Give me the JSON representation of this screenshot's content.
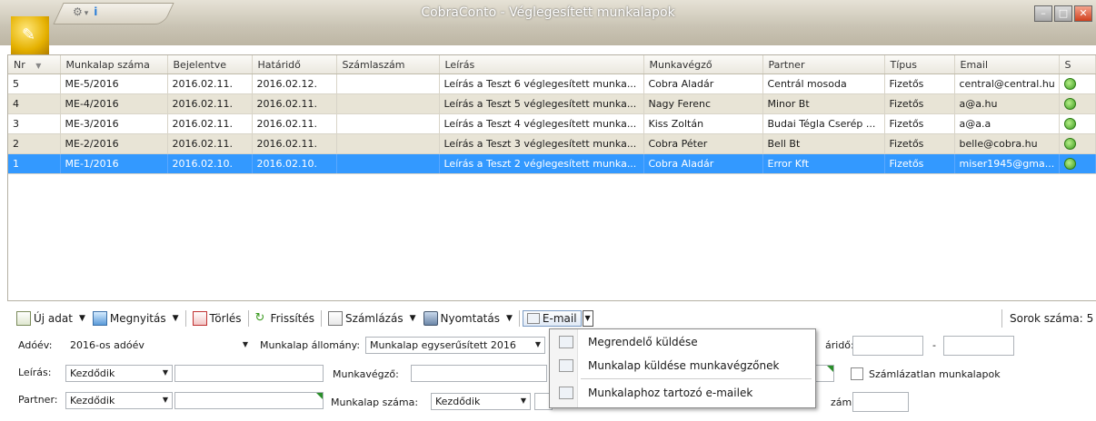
{
  "window": {
    "title": "CobraConto - Véglegesített munkalapok"
  },
  "grid": {
    "columns": [
      "Nr",
      "Munkalap száma",
      "Bejelentve",
      "Határidő",
      "Számlaszám",
      "Leírás",
      "Munkavégző",
      "Partner",
      "Típus",
      "Email",
      "S"
    ],
    "rows": [
      {
        "nr": "5",
        "munkalap": "ME-5/2016",
        "bejelentve": "2016.02.11.",
        "hatarido": "2016.02.12.",
        "szamlaszam": "",
        "leiras": "Leírás a Teszt 6 véglegesített munka...",
        "munkavegzo": "Cobra Aladár",
        "partner": "Centrál mosoda",
        "tipus": "Fizetős",
        "email": "central@central.hu"
      },
      {
        "nr": "4",
        "munkalap": "ME-4/2016",
        "bejelentve": "2016.02.11.",
        "hatarido": "2016.02.11.",
        "szamlaszam": "",
        "leiras": "Leírás a Teszt 5 véglegesített munka...",
        "munkavegzo": "Nagy Ferenc",
        "partner": "Minor Bt",
        "tipus": "Fizetős",
        "email": "a@a.hu"
      },
      {
        "nr": "3",
        "munkalap": "ME-3/2016",
        "bejelentve": "2016.02.11.",
        "hatarido": "2016.02.11.",
        "szamlaszam": "",
        "leiras": "Leírás a Teszt 4 véglegesített munka...",
        "munkavegzo": "Kiss Zoltán",
        "partner": "Budai Tégla Cserép ...",
        "tipus": "Fizetős",
        "email": "a@a.a"
      },
      {
        "nr": "2",
        "munkalap": "ME-2/2016",
        "bejelentve": "2016.02.11.",
        "hatarido": "2016.02.11.",
        "szamlaszam": "",
        "leiras": "Leírás a Teszt 3 véglegesített munka...",
        "munkavegzo": "Cobra Péter",
        "partner": "Bell Bt",
        "tipus": "Fizetős",
        "email": "belle@cobra.hu"
      },
      {
        "nr": "1",
        "munkalap": "ME-1/2016",
        "bejelentve": "2016.02.10.",
        "hatarido": "2016.02.10.",
        "szamlaszam": "",
        "leiras": "Leírás a Teszt 2 véglegesített munka...",
        "munkavegzo": "Cobra Aladár",
        "partner": "Error Kft",
        "tipus": "Fizetős",
        "email": "miser1945@gma..."
      }
    ]
  },
  "toolbar": {
    "new": "Új adat",
    "open": "Megnyitás",
    "delete": "Törlés",
    "refresh": "Frissítés",
    "invoice": "Számlázás",
    "print": "Nyomtatás",
    "email": "E-mail",
    "row_count_label": "Sorok száma:",
    "row_count": "5"
  },
  "filters": {
    "adoev_label": "Adóév:",
    "adoev_value": "2016-os adóév",
    "allomany_label": "Munkalap állomány:",
    "allomany_value": "Munkalap egyserűsített 2016",
    "leiras_label": "Leírás:",
    "leiras_mode": "Kezdődik",
    "munkavegzo_label": "Munkavégző:",
    "partner_label": "Partner:",
    "partner_mode": "Kezdődik",
    "munkalap_szama_label": "Munkalap száma:",
    "munkalap_szama_mode": "Kezdődik",
    "hatarido_label_partial": "áridő:",
    "dash": "-",
    "szam_label_partial": "zám:",
    "szamlazatlan_label": "Számlázatlan munkalapok"
  },
  "email_menu": {
    "items": [
      "Megrendelő küldése",
      "Munkalap küldése munkavégzőnek",
      "Munkalaphoz tartozó e-mailek"
    ]
  }
}
